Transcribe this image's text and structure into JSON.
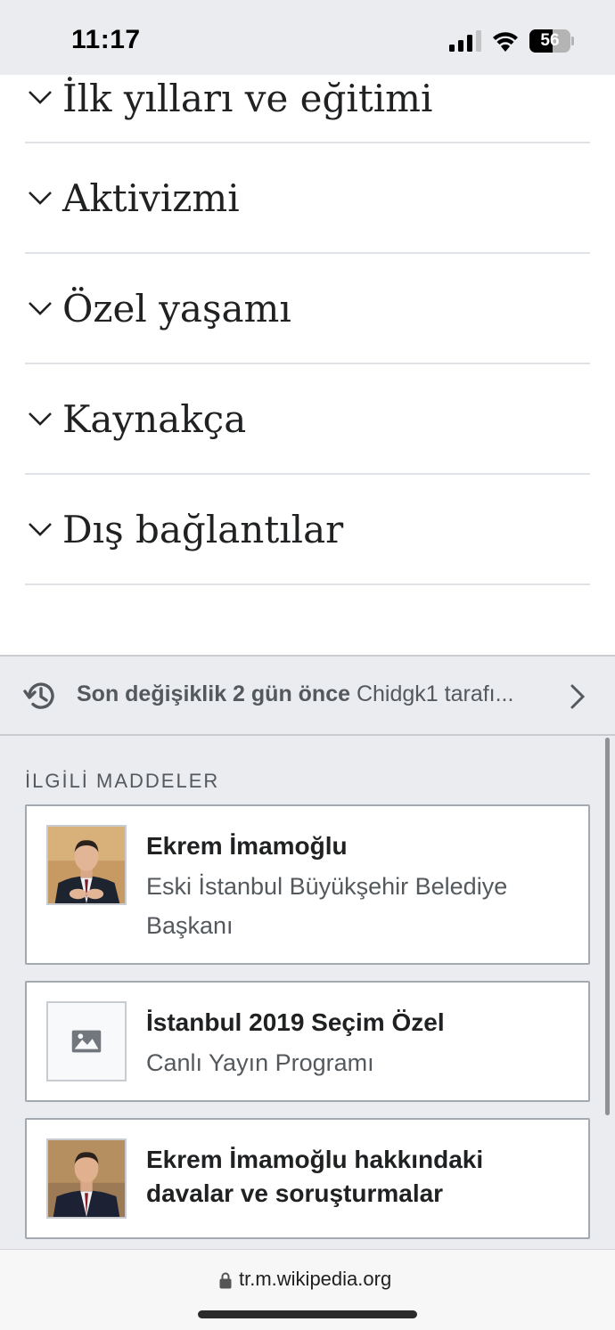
{
  "status_bar": {
    "time": "11:17",
    "battery_level": "56",
    "battery_fraction": 0.56
  },
  "sections": [
    {
      "title": "İlk yılları ve eğitimi",
      "icon": "chevron-down-icon"
    },
    {
      "title": "Aktivizmi",
      "icon": "chevron-down-icon"
    },
    {
      "title": "Özel yaşamı",
      "icon": "chevron-down-icon"
    },
    {
      "title": "Kaynakça",
      "icon": "chevron-down-icon"
    },
    {
      "title": "Dış bağlantılar",
      "icon": "chevron-down-icon"
    }
  ],
  "last_modified": {
    "label": "Son değişiklik 2 gün önce",
    "editor": "Chidgk1 tarafı..."
  },
  "related": {
    "heading": "İLGİLİ MADDELER",
    "cards": [
      {
        "title": "Ekrem İmamoğlu",
        "description": "Eski İstanbul Büyükşehir Belediye Başkanı",
        "thumb": "portrait-photo"
      },
      {
        "title": "İstanbul 2019 Seçim Özel",
        "description": "Canlı Yayın Programı",
        "thumb": "image-placeholder-icon"
      },
      {
        "title": "Ekrem İmamoğlu hakkındaki davalar ve soruşturmalar",
        "description": "",
        "thumb": "portrait-photo"
      }
    ]
  },
  "url_bar": {
    "url": "tr.m.wikipedia.org"
  },
  "colors": {
    "chrome_bg": "#eaecf0",
    "divider": "#dfe2e6",
    "text": "#202122",
    "subtle_text": "#54595d"
  }
}
